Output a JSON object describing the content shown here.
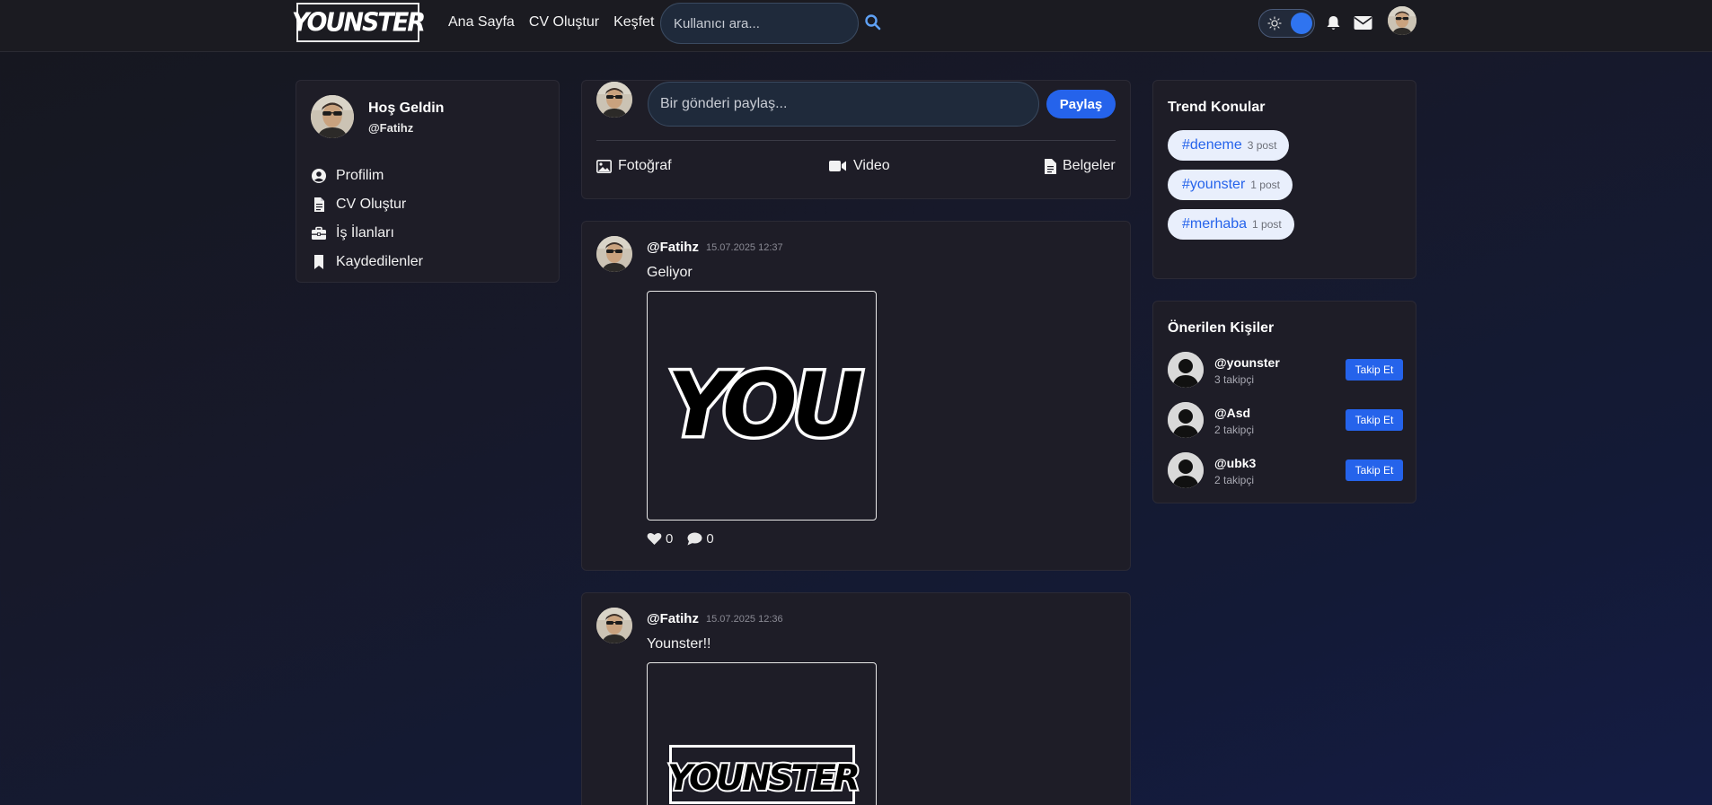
{
  "navbar": {
    "logo_text": "YOUNSTER",
    "links": [
      "Ana Sayfa",
      "CV Oluştur",
      "Keşfet"
    ],
    "search_placeholder": "Kullanıcı ara..."
  },
  "welcome": {
    "title": "Hoş Geldin",
    "handle": "@Fatihz",
    "menu": [
      {
        "label": "Profilim",
        "icon": "user-circle-icon"
      },
      {
        "label": "CV Oluştur",
        "icon": "document-icon"
      },
      {
        "label": "İş İlanları",
        "icon": "briefcase-icon"
      },
      {
        "label": "Kaydedilenler",
        "icon": "bookmark-icon"
      }
    ]
  },
  "composer": {
    "placeholder": "Bir gönderi paylaş...",
    "share_label": "Paylaş",
    "actions": [
      {
        "label": "Fotoğraf",
        "icon": "image-icon"
      },
      {
        "label": "Video",
        "icon": "video-icon"
      },
      {
        "label": "Belgeler",
        "icon": "file-icon"
      }
    ]
  },
  "posts": [
    {
      "user": "@Fatihz",
      "time": "15.07.2025 12:37",
      "text": "Geliyor",
      "image_text": "YOU",
      "likes": "0",
      "comments": "0"
    },
    {
      "user": "@Fatihz",
      "time": "15.07.2025 12:36",
      "text": "Younster!!",
      "image_text": "YOUNSTER"
    }
  ],
  "trends": {
    "title": "Trend Konular",
    "items": [
      {
        "tag": "#deneme",
        "count": "3 post"
      },
      {
        "tag": "#younster",
        "count": "1 post"
      },
      {
        "tag": "#merhaba",
        "count": "1 post"
      }
    ]
  },
  "suggested": {
    "title": "Önerilen Kişiler",
    "follow_label": "Takip Et",
    "people": [
      {
        "name": "@younster",
        "followers": "3 takipçi"
      },
      {
        "name": "@Asd",
        "followers": "2 takipçi"
      },
      {
        "name": "@ubk3",
        "followers": "2 takipçi"
      }
    ]
  },
  "colors": {
    "accent": "#2563eb",
    "card": "#1e1d27",
    "navbar": "#1b1b21"
  }
}
